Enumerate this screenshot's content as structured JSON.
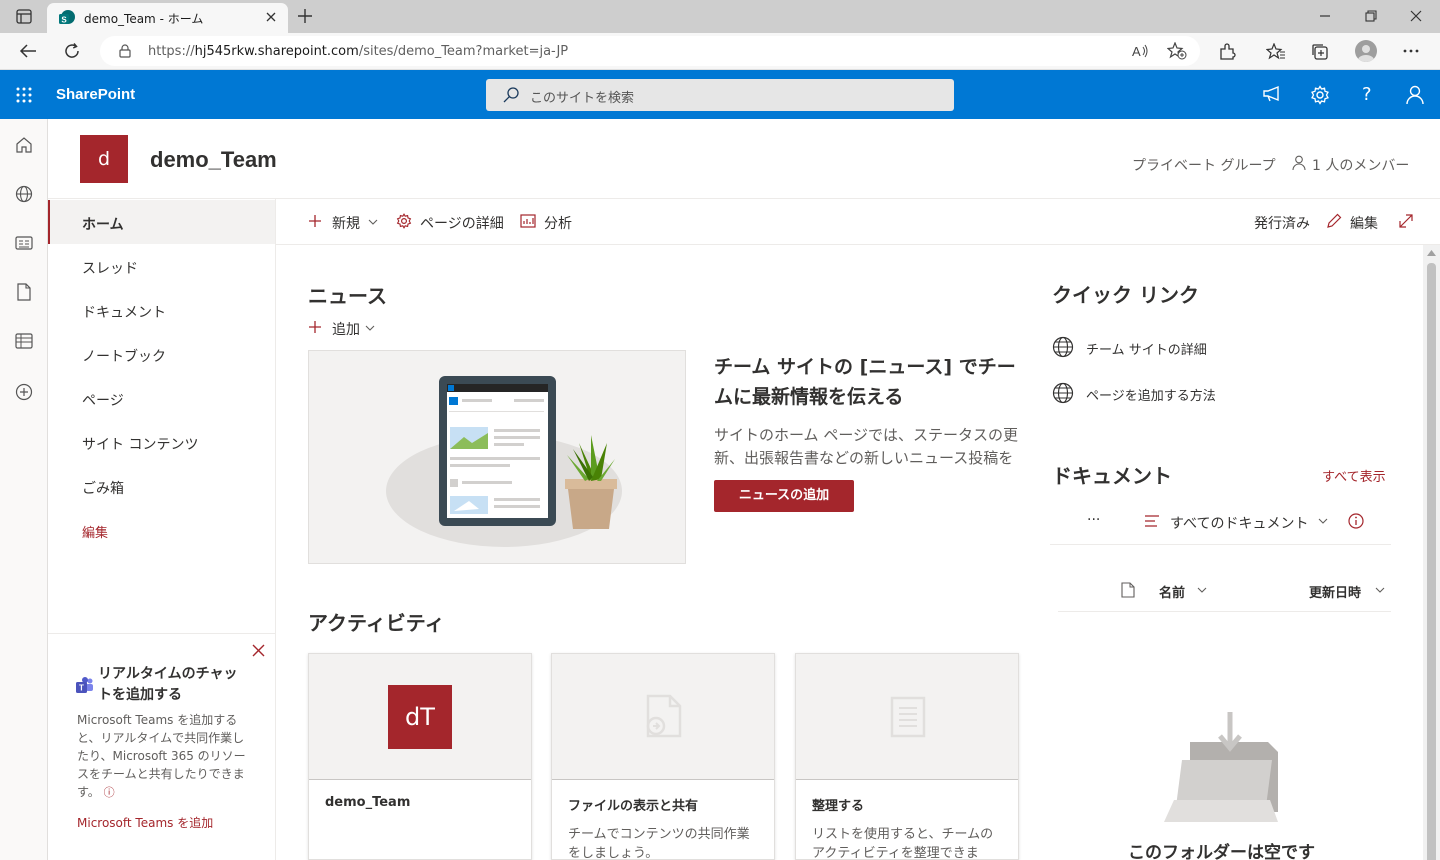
{
  "browser": {
    "tab_title": "demo_Team - ホーム",
    "url_prefix": "https://",
    "url_domain": "hj545rkw.sharepoint.com",
    "url_path": "/sites/demo_Team?market=ja-JP"
  },
  "suite": {
    "brand": "SharePoint",
    "search_placeholder": "このサイトを検索"
  },
  "site": {
    "logo_letter": "d",
    "title": "demo_Team",
    "privacy": "プライベート グループ",
    "members": "1 人のメンバー"
  },
  "nav": {
    "items": [
      "ホーム",
      "スレッド",
      "ドキュメント",
      "ノートブック",
      "ページ",
      "サイト コンテンツ",
      "ごみ箱"
    ],
    "edit": "編集"
  },
  "teams_promo": {
    "title": "リアルタイムのチャットを追加する",
    "body": "Microsoft Teams を追加すると、リアルタイムで共同作業したり、Microsoft 365 のリソースをチームと共有したりできます。",
    "link": "Microsoft Teams を追加"
  },
  "commands": {
    "new": "新規",
    "page_details": "ページの詳細",
    "analytics": "分析",
    "published": "発行済み",
    "edit": "編集"
  },
  "news": {
    "heading": "ニュース",
    "add": "追加",
    "card_title": "チーム サイトの [ニュース] でチームに最新情報を伝える",
    "card_body": "サイトのホーム ページでは、ステータスの更新、出張報告書などの新しいニュース投稿を簡単に作成できます。",
    "add_button": "ニュースの追加"
  },
  "activity": {
    "heading": "アクティビティ",
    "cards": [
      {
        "badge": "dT",
        "title": "demo_Team",
        "desc": ""
      },
      {
        "title": "ファイルの表示と共有",
        "desc": "チームでコンテンツの共同作業をしましょう。"
      },
      {
        "title": "整理する",
        "desc": "リストを使用すると、チームのアクティビティを整理できます。"
      }
    ]
  },
  "quick_links": {
    "heading": "クイック リンク",
    "items": [
      "チーム サイトの詳細",
      "ページを追加する方法"
    ]
  },
  "documents": {
    "heading": "ドキュメント",
    "see_all": "すべて表示",
    "more": "···",
    "view": "すべてのドキュメント",
    "col_name": "名前",
    "col_modified": "更新日時",
    "empty": "このフォルダーは空です"
  },
  "colors": {
    "brand_blue": "#0078d4",
    "accent_red": "#a4262c"
  }
}
